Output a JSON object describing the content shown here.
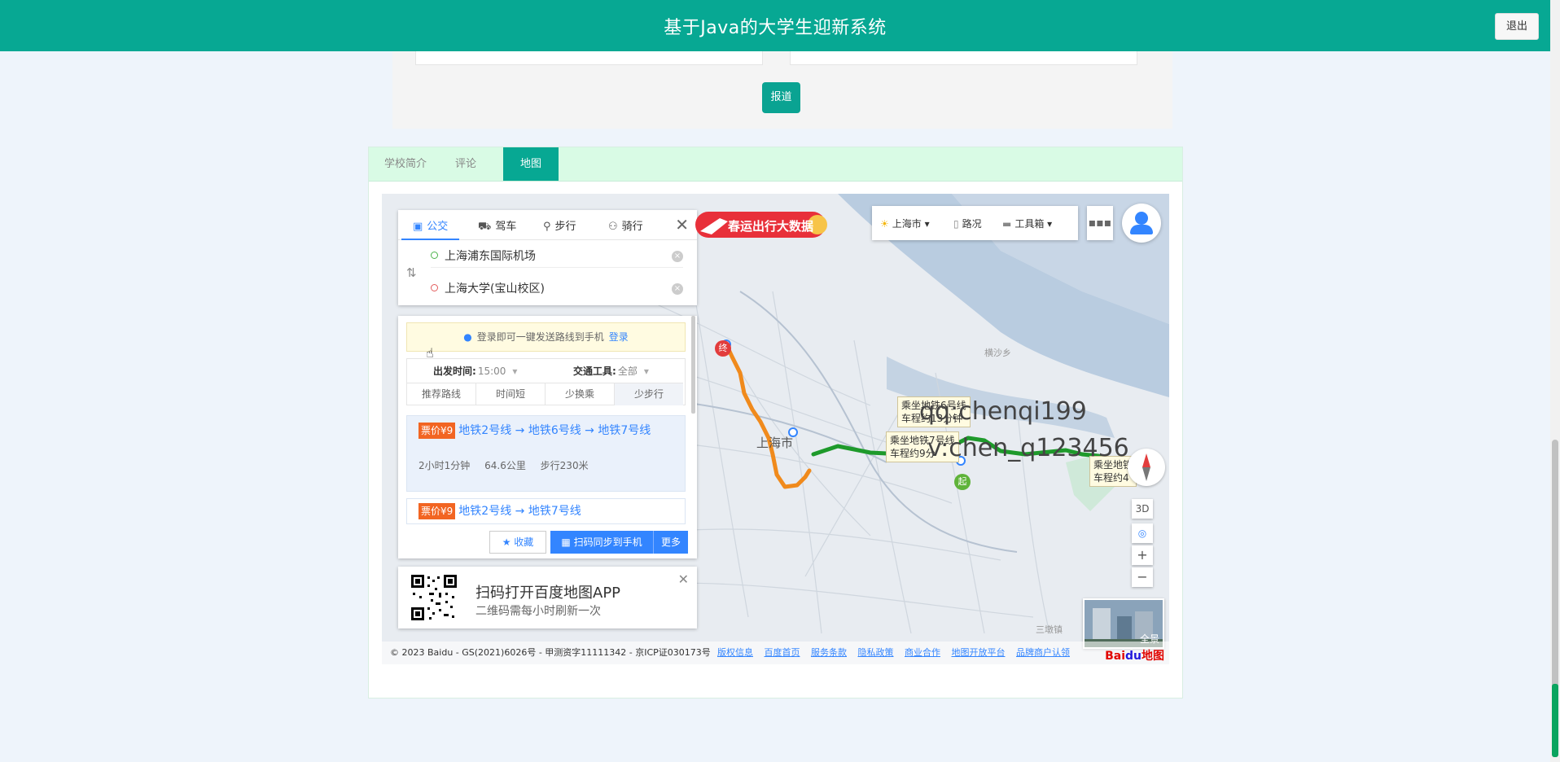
{
  "header": {
    "title": "基于Java的大学生迎新系统",
    "logout_label": "退出"
  },
  "form": {
    "report_label": "报道"
  },
  "tabs": [
    {
      "label": "学校简介"
    },
    {
      "label": "评论"
    },
    {
      "label": "地图"
    }
  ],
  "map": {
    "modes": [
      "公交",
      "驾车",
      "步行",
      "骑行"
    ],
    "origin": "上海浦东国际机场",
    "destination": "上海大学(宝山校区)",
    "login_tip": "登录即可一键发送路线到手机",
    "login_link": "登录",
    "depart_label": "出发时间:",
    "depart_value": "15:00",
    "vehicle_label": "交通工具:",
    "vehicle_value": "全部",
    "sort_options": [
      "推荐路线",
      "时间短",
      "少换乘",
      "少步行"
    ],
    "plans": [
      {
        "price": "票价¥9",
        "route": "地铁2号线 → 地铁6号线 → 地铁7号线",
        "duration": "2小时1分钟",
        "distance": "64.6公里",
        "walk": "步行230米"
      },
      {
        "price": "票价¥9",
        "route": "地铁2号线 → 地铁7号线"
      }
    ],
    "fav_label": "收藏",
    "sync_label": "扫码同步到手机",
    "more_label": "更多",
    "qr_title": "扫码打开百度地图APP",
    "qr_sub": "二维码需每小时刷新一次",
    "banner_text": "春运出行大数据",
    "city": "上海市",
    "traffic": "路况",
    "toolbox": "工具箱",
    "city_label": "上海市",
    "place_1": "横沙乡",
    "place_2": "三墩镇",
    "tips": [
      "乘坐地铁6号线\n车程约13分钟",
      "乘坐地铁7号线\n车程约9分",
      "乘坐地铁\n车程约4"
    ],
    "watermark_1": "qq:chenqi199",
    "watermark_2": "v:chen_q123456",
    "end_marker": "终",
    "start_marker": "起",
    "btn_3d": "3D",
    "zoom_in": "+",
    "zoom_out": "−",
    "panorama_label": "全景",
    "footer_copy": "© 2023 Baidu - GS(2021)6026号 - 甲测资字11111342 - 京ICP证030173号",
    "footer_links": [
      "版权信息",
      "百度首页",
      "服务条款",
      "隐私政策",
      "商业合作",
      "地图开放平台",
      "品牌商户认领"
    ],
    "baidu_logo": "Bai",
    "baidu_logo_du": "du",
    "baidu_logo_map": "地图"
  },
  "colors": {
    "brand": "#07a893",
    "route_orange": "#f08a1c",
    "route_green": "#1e9a2b",
    "link_blue": "#3385ff"
  }
}
